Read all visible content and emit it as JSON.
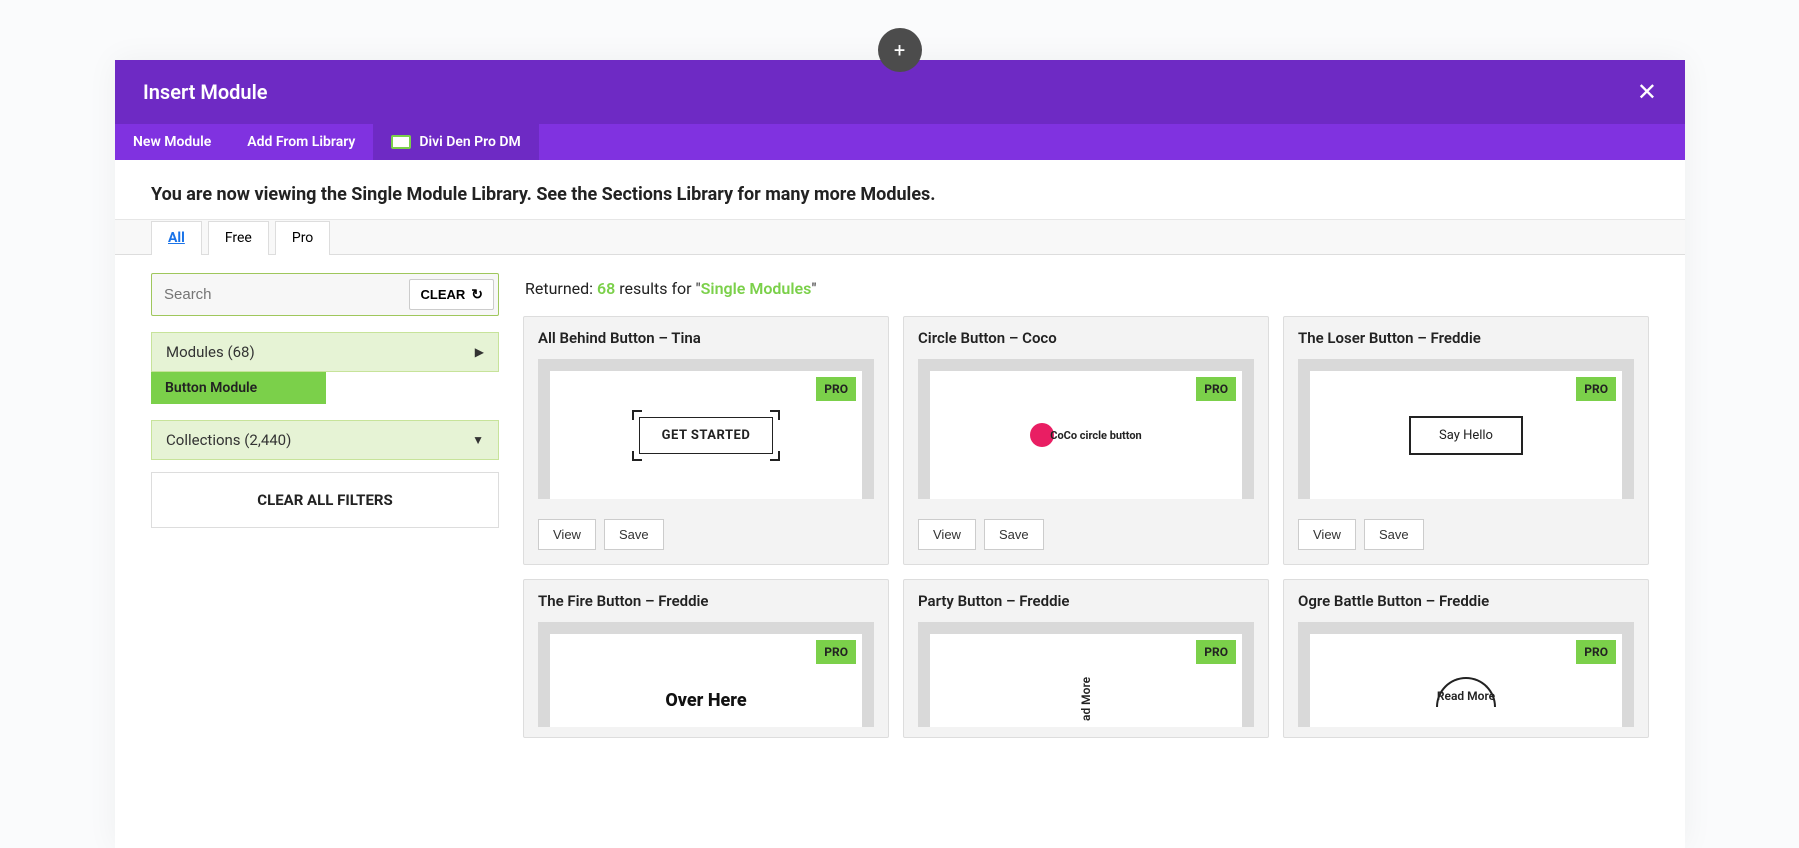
{
  "fab": "+",
  "header": {
    "title": "Insert Module",
    "close": "✕"
  },
  "tabs": [
    {
      "label": "New Module",
      "active": false
    },
    {
      "label": "Add From Library",
      "active": false
    },
    {
      "label": "Divi Den Pro DM",
      "active": true
    }
  ],
  "announce": "You are now viewing the Single Module Library. See the Sections Library for many more Modules.",
  "filter_tabs": [
    {
      "label": "All",
      "active": true
    },
    {
      "label": "Free",
      "active": false
    },
    {
      "label": "Pro",
      "active": false
    }
  ],
  "search": {
    "placeholder": "Search",
    "clear_label": "CLEAR"
  },
  "accordions": {
    "modules": {
      "label": "Modules",
      "count": "(68)"
    },
    "chip": "Button Module",
    "collections": {
      "label": "Collections",
      "count": "(2,440)"
    }
  },
  "clear_all": "CLEAR ALL FILTERS",
  "results_head": {
    "prefix": "Returned: ",
    "count": "68",
    "middle": " results for \"",
    "query": "Single Modules",
    "suffix": "\""
  },
  "badge": "PRO",
  "actions": {
    "view": "View",
    "save": "Save"
  },
  "cards": [
    {
      "title": "All Behind Button – Tina",
      "kind": "corners",
      "text": "GET STARTED"
    },
    {
      "title": "Circle Button – Coco",
      "kind": "circle",
      "text": "CoCo circle button"
    },
    {
      "title": "The Loser Button – Freddie",
      "kind": "hello",
      "text": "Say Hello"
    },
    {
      "title": "The Fire Button – Freddie",
      "kind": "overhere",
      "text": "Over Here"
    },
    {
      "title": "Party Button – Freddie",
      "kind": "vertical",
      "text": "ad More"
    },
    {
      "title": "Ogre Battle Button – Freddie",
      "kind": "arc",
      "text": "Read More"
    }
  ]
}
